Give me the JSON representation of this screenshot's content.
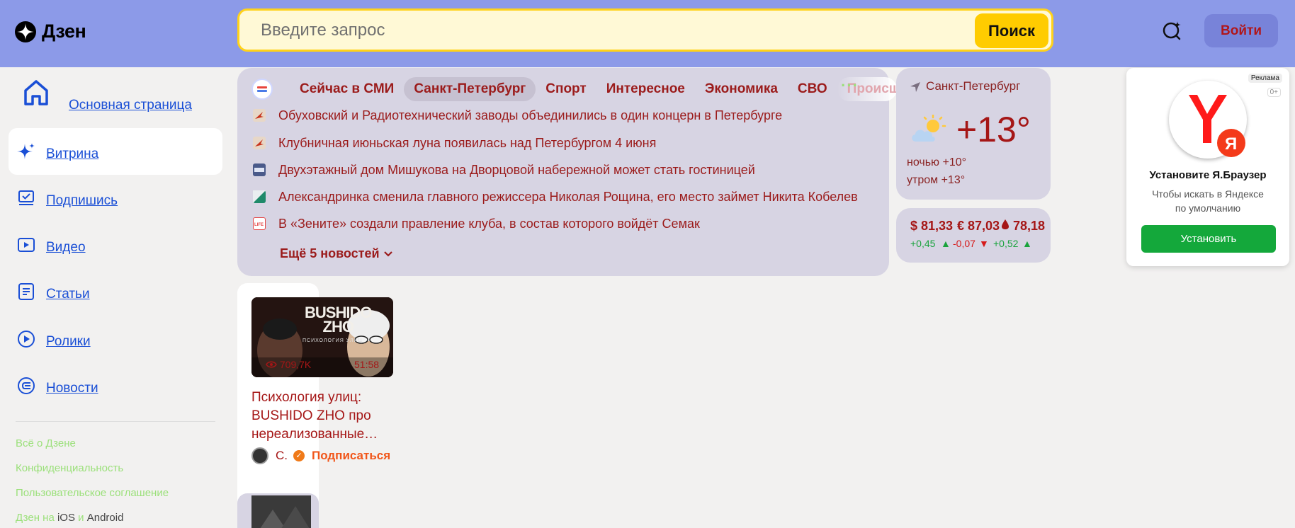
{
  "header": {
    "logo_text": "Дзен",
    "search_placeholder": "Введите запрос",
    "search_button": "Поиск",
    "login_button": "Войти"
  },
  "sidebar": {
    "home": "Основная страница",
    "items": [
      {
        "label": "Витрина",
        "icon": "sparkle-icon"
      },
      {
        "label": "Подпишись",
        "icon": "subscribe-icon"
      },
      {
        "label": "Видео",
        "icon": "video-icon"
      },
      {
        "label": "Статьи",
        "icon": "article-icon"
      },
      {
        "label": "Ролики",
        "icon": "shorts-icon"
      },
      {
        "label": "Новости",
        "icon": "news-icon"
      }
    ],
    "footer": {
      "about": "Всё о Дзене",
      "privacy": "Конфиденциальность",
      "terms": "Пользовательское соглашение",
      "apps_prefix": "Дзен на",
      "ios": "iOS",
      "and": "и",
      "android": "Android"
    }
  },
  "news": {
    "tabs": [
      "Сейчас в СМИ",
      "Санкт-Петербург",
      "Спорт",
      "Интересное",
      "Экономика",
      "СВО",
      "Происш"
    ],
    "selected_tab": "Санкт-Петербург",
    "headlines": [
      {
        "text": "Обуховский и Радиотехнический заводы объединились в один концерн в Петербурге",
        "icon_color": "#e7d7c7"
      },
      {
        "text": "Клубничная июньская луна появилась над Петербургом 4 июня",
        "icon_color": "#e7d7c7"
      },
      {
        "text": "Двухэтажный дом Мишукова на Дворцовой набережной может стать гостиницей",
        "icon_color": "#4a5a8a"
      },
      {
        "text": "Александринка сменила главного режиссера Николая Рощина, его место займет Никита Кобелев",
        "icon_color": "#1f8a6a"
      },
      {
        "text": "В «Зените» создали правление клуба, в состав которого войдёт Семак",
        "icon_color": "#ffffff"
      }
    ],
    "more": "Ещё 5 новостей"
  },
  "weather": {
    "location": "Санкт-Петербург",
    "temp": "+13°",
    "night": "ночью +10°",
    "morning": "утром +13°"
  },
  "rates": {
    "usd": "$ 81,33",
    "eur": "€ 87,03",
    "oil": "78,18",
    "usd_change": "+0,45",
    "eur_change": "-0,07",
    "oil_change": "+0,52"
  },
  "ad": {
    "badge": "Реклама",
    "age": "0+",
    "title": "Установите Я.Браузер",
    "subtitle_1": "Чтобы искать в Яндексе",
    "subtitle_2": "по умолчанию",
    "button": "Установить"
  },
  "feed": {
    "card": {
      "thumb_title_1": "BUSHIDO",
      "thumb_title_2": "ZHO",
      "thumb_subtitle": "ПСИХОЛОГИЯ УЛИЦ",
      "views": "709,7K",
      "duration": "51:58",
      "title": "Психология улиц: BUSHIDO ZHO про нереализованные…",
      "author": "С.",
      "subscribe": "Подписаться"
    }
  },
  "colors": {
    "header_bg": "#8c9ae8",
    "accent_yellow": "#ffcc00",
    "text_red": "#9b1b1b",
    "panel_bg": "#d7d4e3"
  }
}
